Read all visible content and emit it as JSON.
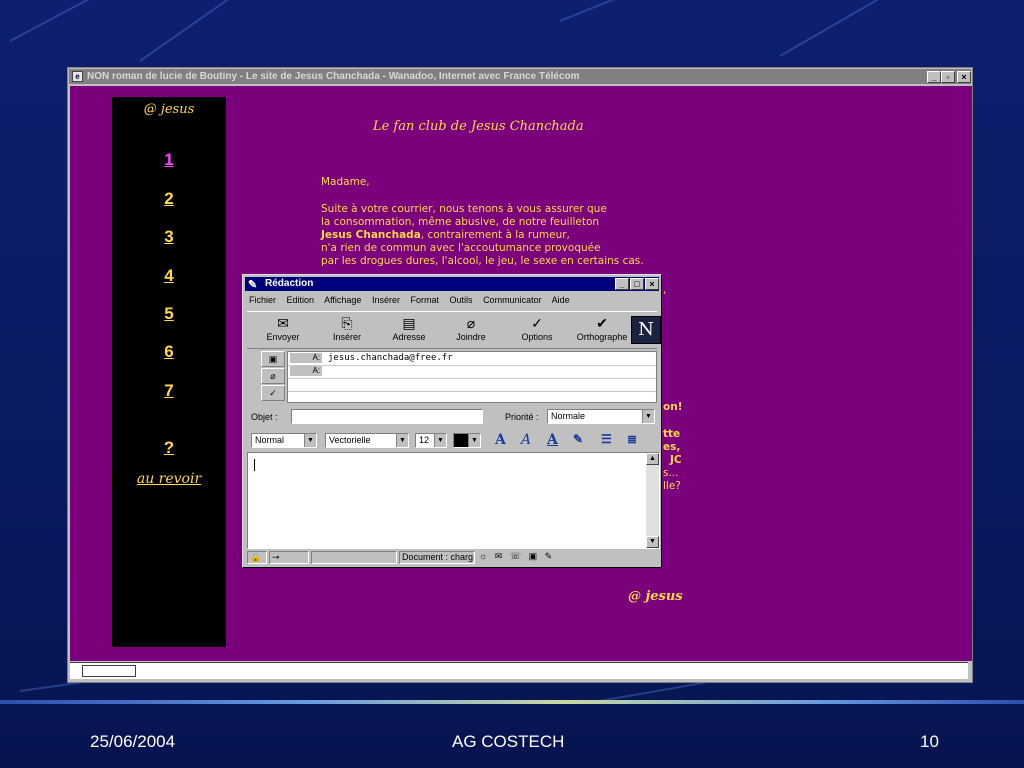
{
  "browser": {
    "title": "NON roman de lucie de Boutiny - Le site de Jesus Chanchada - Wanadoo, Internet avec France Télécom"
  },
  "page": {
    "nav": {
      "title": "@ jesus",
      "items": [
        "1",
        "2",
        "3",
        "4",
        "5",
        "6",
        "7"
      ],
      "help": "?",
      "bye": "au revoir"
    },
    "heading": "Le fan club de Jesus Chanchada",
    "letter": {
      "salutation": "Madame,",
      "line1": "Suite à  votre courrier, nous tenons à vous assurer que",
      "line2": "la consommation, même abusive, de notre feuilleton",
      "line3_bold": "Jesus Chanchada",
      "line3_rest": ", contrairement à  la rumeur,",
      "line4": "n'a rien de commun avec l'accoutumance provoquée",
      "line5": "par les drogues dures, l'alcool, le jeu, le sexe en certains cas."
    },
    "fragments": {
      "f1": ",",
      "f2": "on!",
      "f3": "tte",
      "f4": "es,",
      "f5": "JC",
      "f6": "s...",
      "f7": "lle?"
    },
    "signature": "@ jesus"
  },
  "compose": {
    "title": "Rédaction",
    "menu": [
      "Fichier",
      "Edition",
      "Affichage",
      "Insérer",
      "Format",
      "Outils",
      "Communicator",
      "Aide"
    ],
    "toolbar": [
      "Envoyer",
      "Insérer",
      "Adresse",
      "Joindre",
      "Options",
      "Orthographe"
    ],
    "logo": "N",
    "address_label": "A:",
    "to_value": "jesus.chanchada@free.fr",
    "subject_label": "Objet :",
    "subject_value": "",
    "priority_label": "Priorité :",
    "priority_value": "Normale",
    "format_style": "Normal",
    "font": "Vectorielle",
    "font_size": "12",
    "status_text": "Document : charg"
  },
  "slide_footer": {
    "date": "25/06/2004",
    "center": "AG COSTECH",
    "page": "10"
  }
}
